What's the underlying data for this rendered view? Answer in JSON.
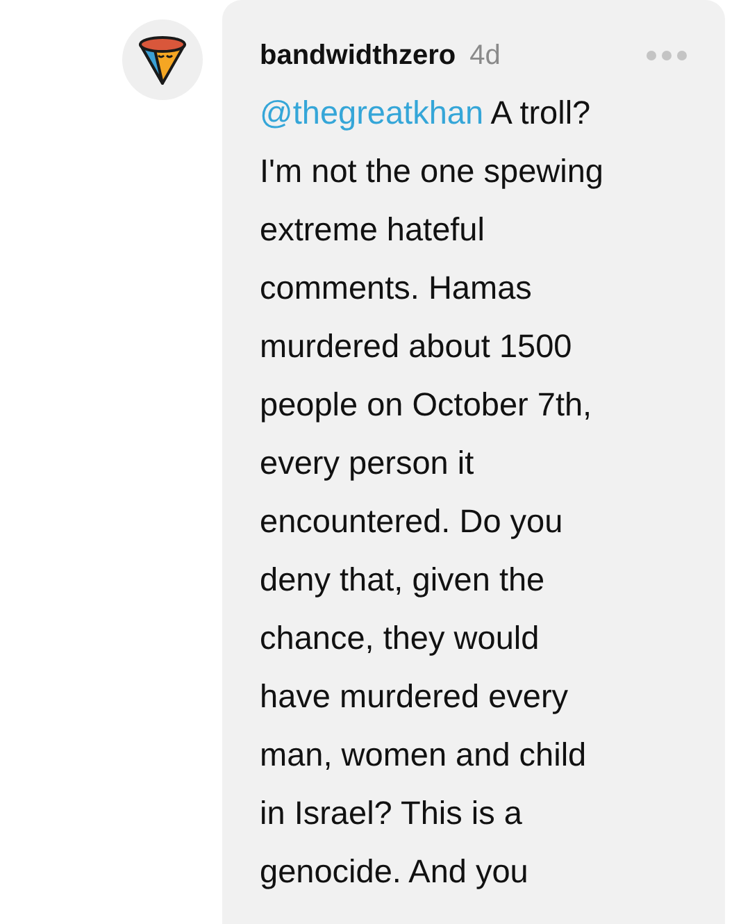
{
  "comment": {
    "username": "bandwidthzero",
    "time": "4d",
    "mention": "@thegreatkhan",
    "lines": [
      "A troll?",
      "I'm not the one spewing",
      "extreme hateful",
      "comments. Hamas",
      "murdered about 1500",
      "people on October 7th,",
      "every person it",
      "encountered. Do you",
      "deny that, given the",
      "chance, they would",
      "have murdered every",
      "man, women and child",
      "in Israel? This is a",
      "genocide. And you"
    ]
  }
}
